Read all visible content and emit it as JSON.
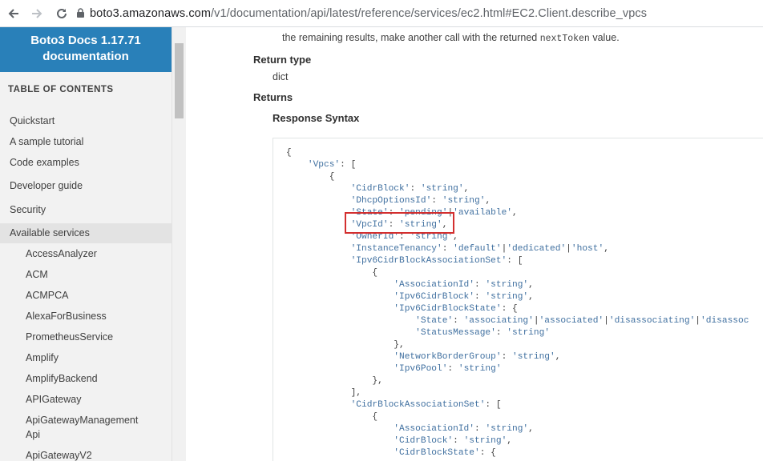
{
  "browser": {
    "url_host": "boto3.amazonaws.com",
    "url_path": "/v1/documentation/api/latest/reference/services/ec2.html#EC2.Client.describe_vpcs"
  },
  "sidebar": {
    "brand_line1": "Boto3 Docs 1.17.71",
    "brand_line2": "documentation",
    "toc_title": "TABLE OF CONTENTS",
    "items": [
      {
        "label": "Quickstart",
        "level": 1,
        "active": false
      },
      {
        "label": "A sample tutorial",
        "level": 1,
        "active": false
      },
      {
        "label": "Code examples",
        "level": 1,
        "active": false
      },
      {
        "label": "Developer guide",
        "level": 1,
        "active": false
      },
      {
        "label": "Security",
        "level": 1,
        "active": false
      },
      {
        "label": "Available services",
        "level": 1,
        "active": true
      },
      {
        "label": "AccessAnalyzer",
        "level": 2,
        "active": false
      },
      {
        "label": "ACM",
        "level": 2,
        "active": false
      },
      {
        "label": "ACMPCA",
        "level": 2,
        "active": false
      },
      {
        "label": "AlexaForBusiness",
        "level": 2,
        "active": false
      },
      {
        "label": "PrometheusService",
        "level": 2,
        "active": false
      },
      {
        "label": "Amplify",
        "level": 2,
        "active": false
      },
      {
        "label": "AmplifyBackend",
        "level": 2,
        "active": false
      },
      {
        "label": "APIGateway",
        "level": 2,
        "active": false
      },
      {
        "label": "ApiGatewayManagement",
        "level": 2,
        "active": false
      },
      {
        "label": "Api",
        "level": 2,
        "active": false
      },
      {
        "label": "ApiGatewayV2",
        "level": 2,
        "active": false
      }
    ]
  },
  "main": {
    "desc_before": "the remaining results, make another call with the returned",
    "desc_code": "nextToken",
    "desc_after": "value.",
    "return_type_label": "Return type",
    "return_type_value": "dict",
    "returns_label": "Returns",
    "response_syntax_label": "Response Syntax",
    "code_lines": [
      "{",
      "    'Vpcs': [",
      "        {",
      "            'CidrBlock': 'string',",
      "            'DhcpOptionsId': 'string',",
      "            'State': 'pending'|'available',",
      "            'VpcId': 'string',",
      "            'OwnerId': 'string',",
      "            'InstanceTenancy': 'default'|'dedicated'|'host',",
      "            'Ipv6CidrBlockAssociationSet': [",
      "                {",
      "                    'AssociationId': 'string',",
      "                    'Ipv6CidrBlock': 'string',",
      "                    'Ipv6CidrBlockState': {",
      "                        'State': 'associating'|'associated'|'disassociating'|'disassoc",
      "                        'StatusMessage': 'string'",
      "                    },",
      "                    'NetworkBorderGroup': 'string',",
      "                    'Ipv6Pool': 'string'",
      "                },",
      "            ],",
      "            'CidrBlockAssociationSet': [",
      "                {",
      "                    'AssociationId': 'string',",
      "                    'CidrBlock': 'string',",
      "                    'CidrBlockState': {"
    ]
  },
  "colors": {
    "brand_blue": "#2980b9",
    "highlight_red": "#d32f2f"
  }
}
